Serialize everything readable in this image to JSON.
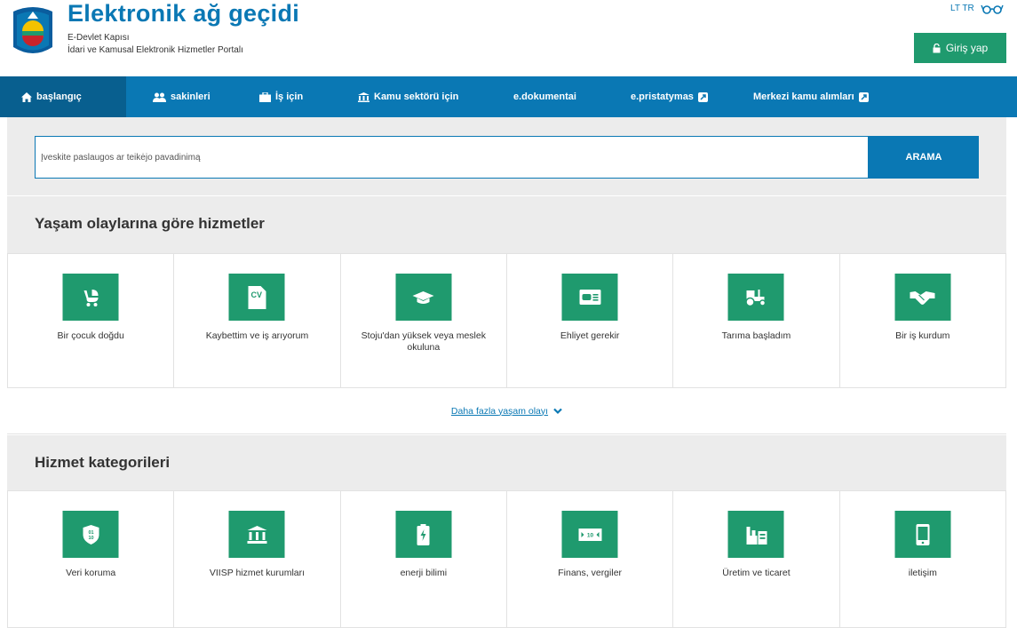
{
  "header": {
    "title": "Elektronik ağ geçidi",
    "subtitle1": "E-Devlet Kapısı",
    "subtitle2": "İdari ve Kamusal Elektronik Hizmetler Portalı",
    "lang": "LT TR",
    "login_label": "Giriş yap"
  },
  "nav": {
    "items": [
      {
        "label": "başlangıç",
        "icon": "home-icon"
      },
      {
        "label": "sakinleri",
        "icon": "people-icon"
      },
      {
        "label": "İş için",
        "icon": "briefcase-icon"
      },
      {
        "label": "Kamu sektörü için",
        "icon": "institution-icon"
      },
      {
        "label": "e.dokumentai"
      },
      {
        "label": "e.pristatymas",
        "icon": "external-link-icon"
      },
      {
        "label": "Merkezi kamu alımları",
        "icon": "external-link-icon"
      }
    ]
  },
  "search": {
    "placeholder": "Įveskite paslaugos ar teikėjo pavadinimą",
    "button_label": "ARAMA"
  },
  "life_events": {
    "title": "Yaşam olaylarına göre hizmetler",
    "tiles": [
      {
        "label": "Bir çocuk doğdu",
        "icon": "stroller-icon"
      },
      {
        "label": "Kaybettim ve iş arıyorum",
        "icon": "cv-icon"
      },
      {
        "label": "Stoju'dan yüksek veya meslek okuluna",
        "icon": "graduation-cap-icon"
      },
      {
        "label": "Ehliyet gerekir",
        "icon": "driver-license-icon"
      },
      {
        "label": "Tarıma başladım",
        "icon": "tractor-icon"
      },
      {
        "label": "Bir iş kurdum",
        "icon": "handshake-icon"
      }
    ],
    "more_label": "Daha fazla yaşam olayı"
  },
  "categories": {
    "title": "Hizmet kategorileri",
    "tiles": [
      {
        "label": "Veri koruma",
        "icon": "data-shield-icon"
      },
      {
        "label": "VIISP hizmet kurumları",
        "icon": "institution-icon"
      },
      {
        "label": "enerji bilimi",
        "icon": "battery-icon"
      },
      {
        "label": "Finans, vergiler",
        "icon": "banknote-icon"
      },
      {
        "label": "Üretim ve ticaret",
        "icon": "factory-icon"
      },
      {
        "label": "iletişim",
        "icon": "phone-icon"
      }
    ],
    "tile_text": {
      "cv": "CV",
      "data": "01 10",
      "banknote": "10"
    }
  },
  "colors": {
    "primary_blue": "#0a78b4",
    "nav_active": "#085f8f",
    "green": "#1f9a6e",
    "band_gray": "#ececec"
  }
}
